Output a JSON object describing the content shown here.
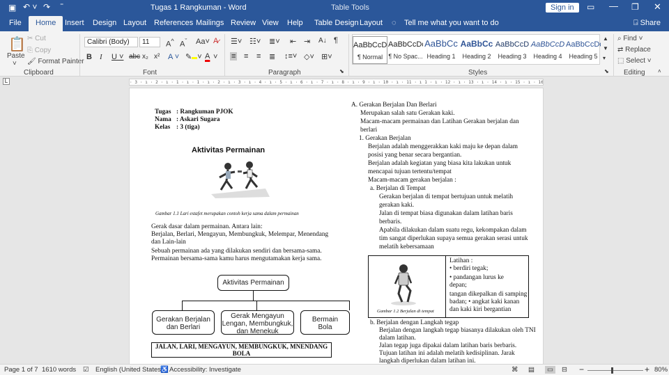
{
  "titlebar": {
    "title": "Tugas 1 Rangkuman - Word",
    "context": "Table Tools",
    "signin": "Sign in"
  },
  "tabs": [
    "File",
    "Home",
    "Insert",
    "Design",
    "Layout",
    "References",
    "Mailings",
    "Review",
    "View",
    "Help",
    "Table Design",
    "Layout"
  ],
  "tell_me": "Tell me what you want to do",
  "share": "Share",
  "clipboard": {
    "paste": "Paste",
    "cut": "Cut",
    "copy": "Copy",
    "format_painter": "Format Painter",
    "label": "Clipboard"
  },
  "font": {
    "name": "Calibri (Body)",
    "size": "11",
    "label": "Font"
  },
  "paragraph": {
    "label": "Paragraph"
  },
  "styles": {
    "label": "Styles",
    "items": [
      {
        "preview": "AaBbCcDc",
        "name": "¶ Normal"
      },
      {
        "preview": "AaBbCcDc",
        "name": "¶ No Spac..."
      },
      {
        "preview": "AaBbCc",
        "name": "Heading 1"
      },
      {
        "preview": "AaBbCc",
        "name": "Heading 2"
      },
      {
        "preview": "AaBbCcD",
        "name": "Heading 3"
      },
      {
        "preview": "AaBbCcD",
        "name": "Heading 4"
      },
      {
        "preview": "AaBbCcDc",
        "name": "Heading 5"
      }
    ]
  },
  "editing": {
    "find": "Find",
    "replace": "Replace",
    "select": "Select",
    "label": "Editing"
  },
  "ruler_text": "· 3 · ı · 2 · ı · 1 · ı · 1 · ı · 2 · ı · 3 · ı · 4 · ı · 5 · ı · 6 · ı · 7 · ı · 8 · ı · 9 · ı · 10 · ı · 11 · ı 1 · ı · 12 · ı · 13 · ı · 14 · ı · 15 · ı · 16 · ı · 17 · ı · 18 · ı · 19 · ı · 20 · ı · 21 · ı · 22 · ı · 23 · ı · 24 ·",
  "doc": {
    "header": [
      {
        "k": "Tugas",
        "v": ": Rangkuman PJOK"
      },
      {
        "k": "Nama",
        "v": ": Askari Sugara"
      },
      {
        "k": "Kelas",
        "v": ": 3 (tiga)"
      }
    ],
    "title": "Aktivitas Permainan",
    "caption1": "Gambar 1.1 Lari estafet merupakan contoh kerja sama dalam permainan",
    "left_para": [
      "Gerak dasar dalam permainan. Antara lain:",
      "Berjalan, Berlari, Mengayun, Membungkuk, Melempar, Menendang",
      "dan Lain-lain",
      "Sebuah permainan ada yang dilakukan sendiri dan bersama-sama.",
      "Permainan bersama-sama kamu harus mengutamakan kerja sama."
    ],
    "diagram": {
      "root": "Aktivitas Permainan",
      "child1": [
        "Gerakan Berjalan",
        "dan Berlari"
      ],
      "child2": [
        "Gerak Mengayun",
        "Lengan, Membungkuk,",
        "dan Menekuk"
      ],
      "child3": [
        "Bermain",
        "Bola"
      ]
    },
    "bottom_box": [
      "JALAN, LARI, MENGAYUN, MEMBUNGKUK, MNENDANG",
      "BOLA"
    ],
    "right": {
      "a_head": "A.  Gerakan Berjalan Dan Berlari",
      "a_lines": [
        "Merupakan salah satu Gerakan kaki.",
        "Macam-macam permainan dan Latihan Gerakan berjalan dan",
        "berlari"
      ],
      "n1": "1.  Gerakan Berjalan",
      "n1_lines": [
        "Berjalan adalah menggerakkan kaki maju ke depan dalam",
        "posisi yang benar secara bergantian.",
        "Berjalan adalah kegiatan yang biasa kita lakukan untuk",
        "mencapai tujuan tertentu/tempat",
        "Macam-macam gerakan berjalan :"
      ],
      "sa": "a.   Berjalan di Tempat",
      "sa_lines": [
        "Gerakan berjalan di tempat bertujuan untuk melatih",
        "gerakan kaki.",
        "Jalan di tempat biasa digunakan dalam  latihan baris",
        "berbaris.",
        "Apabila dilakukan dalam suatu regu, kekompakan dalam",
        "tim sangat diperlukan supaya semua gerakan serasi untuk",
        "melatih kebersamaan"
      ],
      "table_caption": "Gambar 1.2 Berjalan di tempat",
      "latihan": [
        "Latihan :",
        "•     berdiri tegak;",
        "•     pandangan     lurus     ke",
        "       depan;",
        "tangan dikepalkan di samping",
        "badan; • angkat kaki kanan",
        "dan kaki kiri bergantian"
      ],
      "sb": "b.   Berjalan dengan Langkah tegap",
      "sb_lines": [
        "Berjalan dengan langkah tegap biasanya dilakukan oleh TNI",
        "dalam latihan.",
        "Jalan tegap juga dipakai dalam latihan baris berbaris.",
        "Tujuan   latihan   ini   adalah   melatih   kedisiplinan.   Jarak",
        "langkah diperlukan dalam latihan ini."
      ]
    }
  },
  "status": {
    "page": "Page 1 of 7",
    "words": "1610 words",
    "lang": "English (United States)",
    "access": "Accessibility: Investigate",
    "zoom": "80%"
  }
}
